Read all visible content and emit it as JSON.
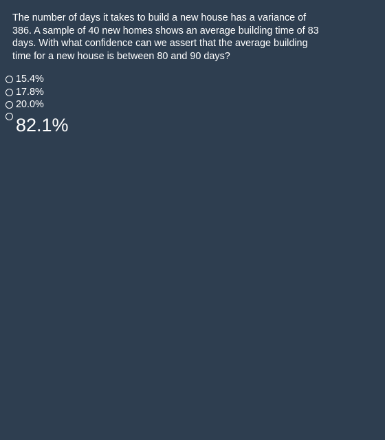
{
  "question": {
    "text": "The number of days it takes to build a new house has a variance of 386. A sample of 40 new homes shows an average building time of 83 days. With what confidence can we assert that the average building time for a new house is between 80 and 90 days?"
  },
  "options": [
    {
      "label": "15.4%"
    },
    {
      "label": "17.8%"
    },
    {
      "label": "20.0%"
    },
    {
      "label": "82.1%"
    }
  ],
  "colors": {
    "background": "#2e3e50",
    "text": "#ffffff"
  }
}
